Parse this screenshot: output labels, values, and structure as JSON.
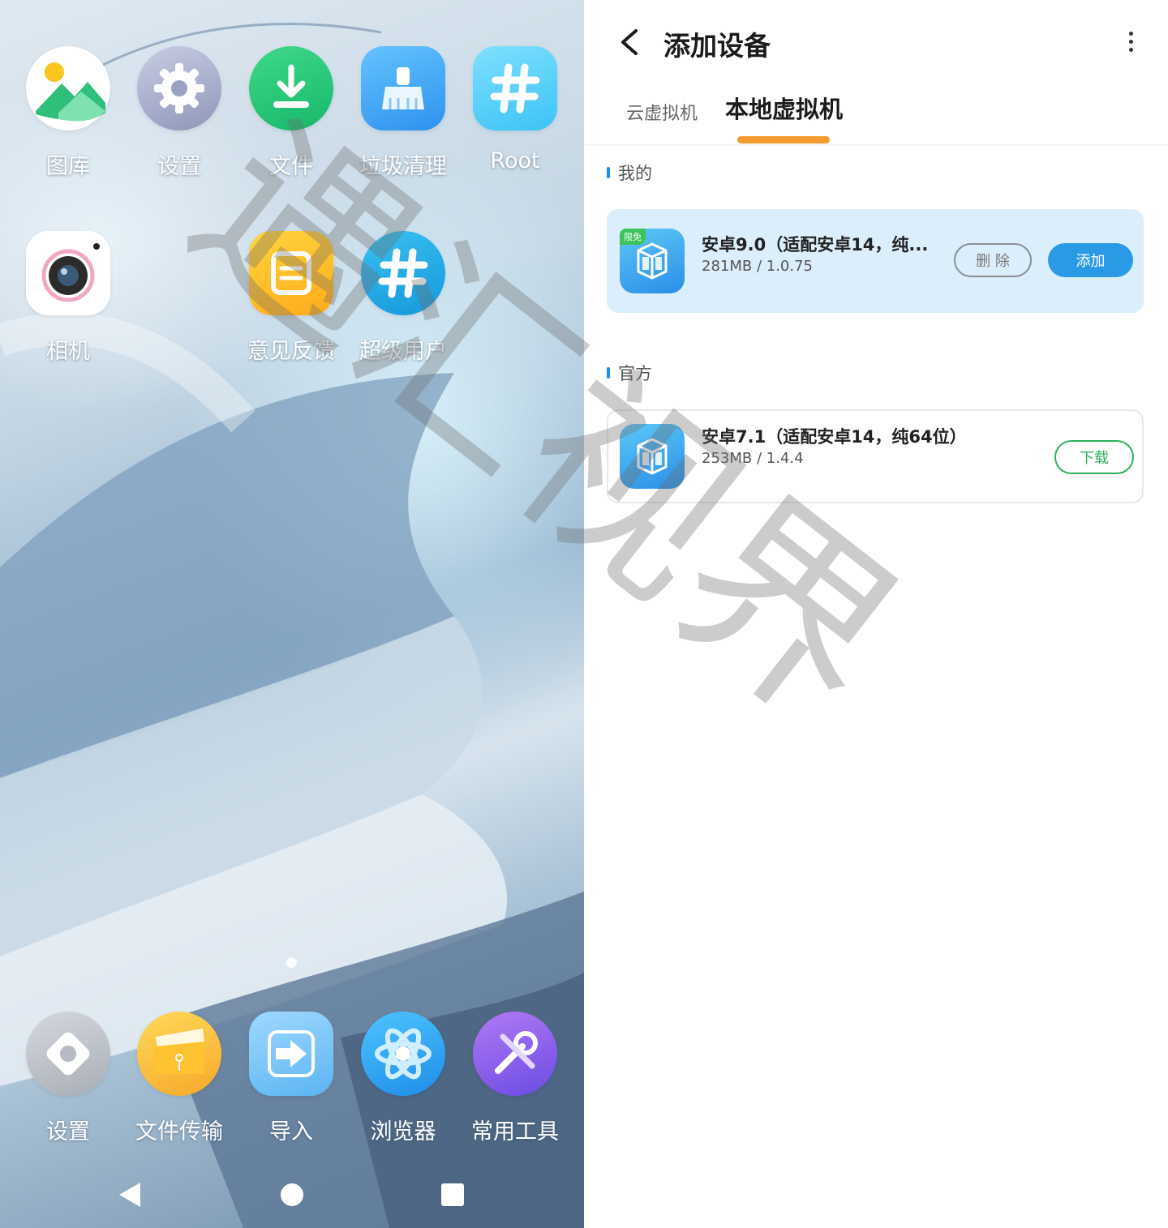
{
  "launcher": {
    "top_row": [
      {
        "name": "gallery-app",
        "icon": "gallery-icon",
        "label": "图库"
      },
      {
        "name": "settings-app",
        "icon": "gear-icon",
        "label": "设置"
      },
      {
        "name": "files-app",
        "icon": "download-icon",
        "label": "文件"
      },
      {
        "name": "cleaner-app",
        "icon": "broom-icon",
        "label": "垃圾清理"
      },
      {
        "name": "root-app",
        "icon": "hash-icon",
        "label": "Root"
      }
    ],
    "second_row": [
      {
        "name": "camera-app",
        "icon": "camera-icon",
        "label": "相机"
      },
      {
        "name": "feedback-app",
        "icon": "feedback-icon",
        "label": "意见反馈"
      },
      {
        "name": "superuser-app",
        "icon": "hash-icon",
        "label": "超级用户"
      }
    ],
    "dock": [
      {
        "name": "dock-settings-app",
        "icon": "diamond-gear-icon",
        "label": "设置"
      },
      {
        "name": "file-transfer-app",
        "icon": "folder-icon",
        "label": "文件传输"
      },
      {
        "name": "import-app",
        "icon": "import-arrow-icon",
        "label": "导入"
      },
      {
        "name": "browser-app",
        "icon": "atom-icon",
        "label": "浏览器"
      },
      {
        "name": "tools-app",
        "icon": "tools-icon",
        "label": "常用工具"
      }
    ],
    "nav": [
      "back-icon",
      "home-icon",
      "recents-icon"
    ]
  },
  "panel": {
    "title": "添加设备",
    "tabs": [
      {
        "label": "云虚拟机",
        "active": false
      },
      {
        "label": "本地虚拟机",
        "active": true
      }
    ],
    "sections": {
      "mine": {
        "header": "我的",
        "item": {
          "badge": "限免",
          "name": "安卓9.0（适配安卓14，纯...",
          "meta": "281MB / 1.0.75",
          "delete_label": "删 除",
          "add_label": "添加"
        }
      },
      "official": {
        "header": "官方",
        "item": {
          "name": "安卓7.1（适配安卓14，纯64位）",
          "meta": "253MB / 1.4.4",
          "download_label": "下载"
        }
      }
    }
  },
  "watermark": "遇汇视界",
  "colors": {
    "accent_blue": "#2a9ae6",
    "tab_indicator": "#f59a30",
    "download_green": "#2bb35a",
    "card_highlight": "#dbeefb"
  }
}
